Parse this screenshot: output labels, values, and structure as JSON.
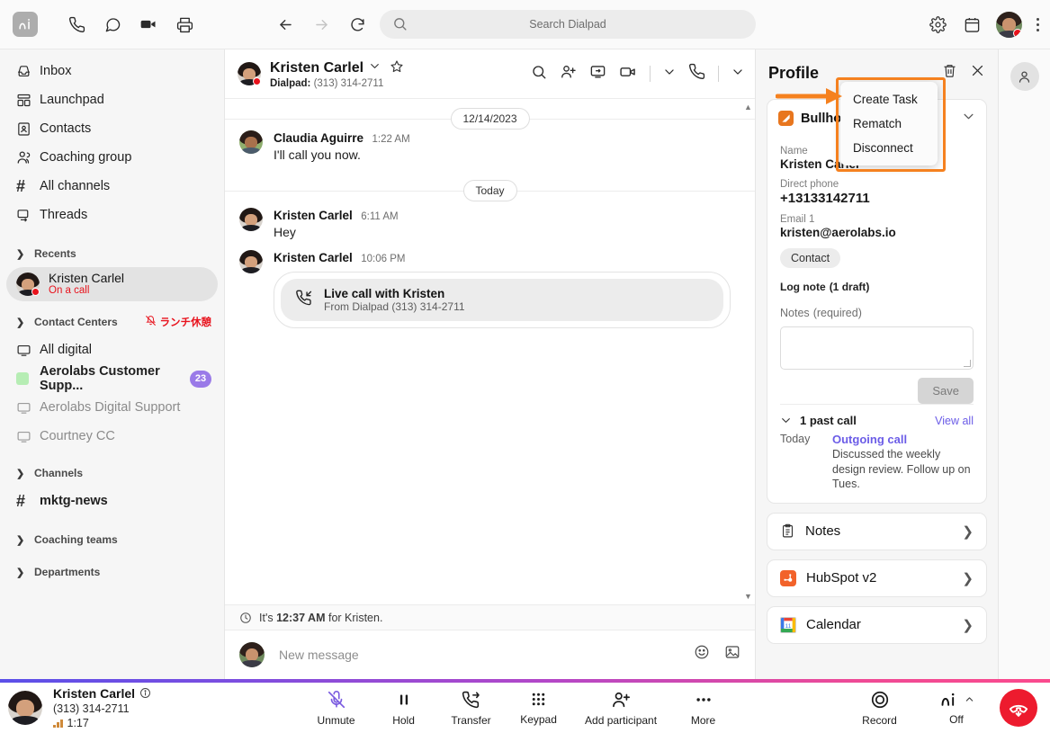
{
  "topbar": {
    "logo_text": "Ni",
    "logo_name": "dialpad-logo",
    "icons": [
      "phone-icon",
      "message-icon",
      "video-icon",
      "print-icon"
    ],
    "nav": [
      "back-arrow-icon",
      "forward-arrow-icon",
      "reload-icon"
    ],
    "search_placeholder": "Search Dialpad",
    "right_icons": [
      "gear-icon",
      "calendar-icon",
      "user-avatar",
      "kebab-menu-icon"
    ]
  },
  "sidebar": {
    "items": [
      {
        "label": "Inbox",
        "icon": "inbox-icon"
      },
      {
        "label": "Launchpad",
        "icon": "launchpad-icon"
      },
      {
        "label": "Contacts",
        "icon": "contacts-icon"
      },
      {
        "label": "Coaching group",
        "icon": "people-icon"
      },
      {
        "label": "All channels",
        "icon": "hash-icon"
      },
      {
        "label": "Threads",
        "icon": "threads-icon"
      }
    ],
    "recents_group": "Recents",
    "recent": {
      "name": "Kristen Carlel",
      "status": "On a call"
    },
    "contact_centers_group": "Contact Centers",
    "contact_centers_status": "ランチ休憩",
    "centers": [
      {
        "label": "All digital",
        "icon": "monitor-icon",
        "muted": false,
        "badge": "",
        "swatch": false
      },
      {
        "label": "Aerolabs Customer Supp...",
        "icon": "swatch",
        "muted": false,
        "badge": "23",
        "swatch": true
      },
      {
        "label": "Aerolabs Digital Support",
        "icon": "monitor-icon",
        "muted": true,
        "badge": "",
        "swatch": false
      },
      {
        "label": "Courtney CC",
        "icon": "monitor-icon",
        "muted": true,
        "badge": "",
        "swatch": false
      }
    ],
    "channels_group": "Channels",
    "channel": "mktg-news",
    "coaching_teams_group": "Coaching teams",
    "departments_group": "Departments"
  },
  "conversation": {
    "header": {
      "name": "Kristen Carlel",
      "subtitle_label": "Dialpad:",
      "subtitle_number": "(313) 314-2711",
      "icons": [
        "search-icon",
        "add-person-icon",
        "screen-share-icon",
        "video-icon",
        "chevron-down-icon",
        "phone-icon",
        "chevron-down-icon"
      ]
    },
    "date_dividers": {
      "first": "12/14/2023",
      "second": "Today"
    },
    "messages": [
      {
        "sender": "Claudia Aguirre",
        "time": "1:22 AM",
        "text": "I'll call you now.",
        "avatar": "c"
      },
      {
        "sender": "Kristen Carlel",
        "time": "6:11 AM",
        "text": "Hey",
        "avatar": "k"
      },
      {
        "sender": "Kristen Carlel",
        "time": "10:06 PM",
        "text": "",
        "avatar": "k"
      }
    ],
    "call_card": {
      "title": "Live call with Kristen",
      "subtitle": "From Dialpad (313) 314-2711",
      "icon": "incoming-call-icon"
    },
    "timezone_note_pre": "It's",
    "timezone_note_time": "12:37 AM",
    "timezone_note_post": "for Kristen.",
    "composer_placeholder": "New message",
    "composer_icons": [
      "emoji-icon",
      "image-icon"
    ]
  },
  "profile": {
    "title": "Profile",
    "header_icons": [
      "trash-icon",
      "close-icon"
    ],
    "integration": {
      "name": "Bullhorn",
      "icon": "bullhorn-icon"
    },
    "fields": [
      {
        "label": "Name",
        "value": "Kristen Carlel"
      },
      {
        "label": "Direct phone",
        "value": "+13133142711"
      },
      {
        "label": "Email 1",
        "value": "kristen@aerolabs.io"
      }
    ],
    "chip": "Contact",
    "log_note_label": "Log note",
    "log_note_count": "(1 draft)",
    "notes_label": "Notes",
    "notes_required": "(required)",
    "notes_value": "",
    "save_label": "Save",
    "past_calls_label": "1 past call",
    "view_all_label": "View all",
    "past_call": {
      "day": "Today",
      "type": "Outgoing call",
      "description": "Discussed the weekly design review. Follow up on Tues."
    },
    "accordions": [
      {
        "label": "Notes",
        "icon": "clipboard-icon"
      },
      {
        "label": "HubSpot v2",
        "icon": "hubspot-icon"
      },
      {
        "label": "Calendar",
        "icon": "calendar-icon"
      }
    ]
  },
  "context_menu": {
    "items": [
      "Create Task",
      "Rematch",
      "Disconnect"
    ],
    "highlight_color": "#f5811f"
  },
  "call_bar": {
    "name": "Kristen Carlel",
    "number": "(313) 314-2711",
    "duration": "1:17",
    "actions": [
      {
        "label": "Unmute",
        "icon": "mic-muted-icon"
      },
      {
        "label": "Hold",
        "icon": "pause-icon"
      },
      {
        "label": "Transfer",
        "icon": "transfer-icon"
      },
      {
        "label": "Keypad",
        "icon": "keypad-icon"
      },
      {
        "label": "Add participant",
        "icon": "add-person-icon"
      },
      {
        "label": "More",
        "icon": "ellipsis-icon"
      }
    ],
    "record_label": "Record",
    "ai_label": "Off",
    "hangup_icon": "hangup-icon"
  },
  "right_rail": {
    "icon": "person-icon"
  }
}
